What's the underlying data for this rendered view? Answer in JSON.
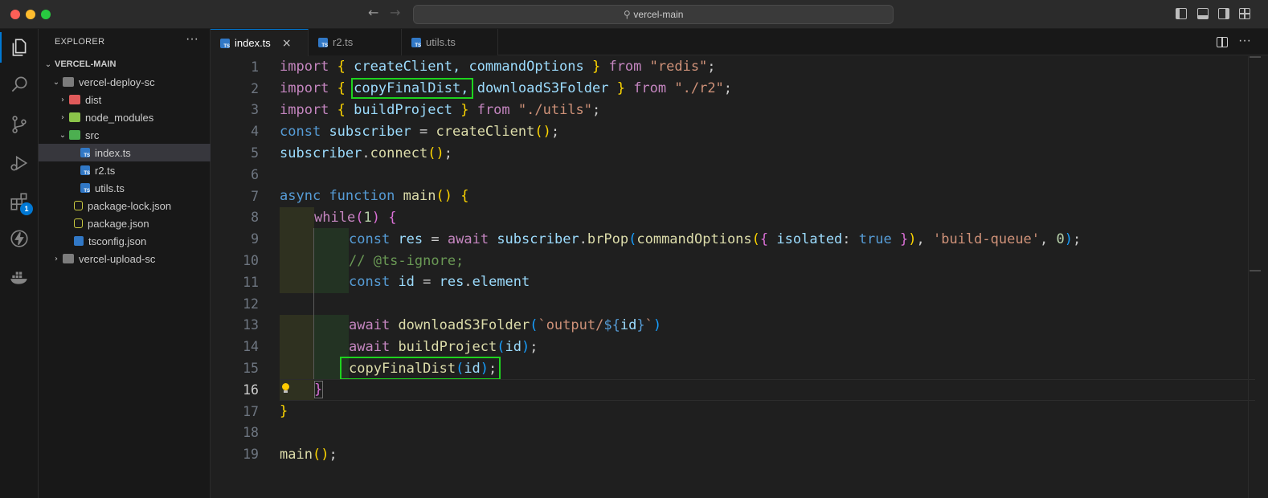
{
  "window": {
    "search_text": "vercel-main"
  },
  "activity_bar": {
    "extensions_badge": "1"
  },
  "sidebar": {
    "title": "EXPLORER",
    "more": "···",
    "root": "VERCEL-MAIN",
    "items": [
      {
        "label": "vercel-deploy-sc"
      },
      {
        "label": "dist"
      },
      {
        "label": "node_modules"
      },
      {
        "label": "src"
      },
      {
        "label": "index.ts"
      },
      {
        "label": "r2.ts"
      },
      {
        "label": "utils.ts"
      },
      {
        "label": "package-lock.json"
      },
      {
        "label": "package.json"
      },
      {
        "label": "tsconfig.json"
      },
      {
        "label": "vercel-upload-sc"
      }
    ]
  },
  "tabs": [
    {
      "label": "index.ts",
      "close": "×"
    },
    {
      "label": "r2.ts"
    },
    {
      "label": "utils.ts"
    }
  ],
  "editor": {
    "line_numbers": [
      "1",
      "2",
      "3",
      "4",
      "5",
      "6",
      "7",
      "8",
      "9",
      "10",
      "11",
      "12",
      "13",
      "14",
      "15",
      "16",
      "17",
      "18",
      "19"
    ],
    "current_line": "16",
    "lines": {
      "l1": [
        "import",
        " ",
        "{",
        " createClient, commandOptions ",
        "}",
        " from ",
        "\"redis\"",
        ";"
      ],
      "l2": [
        "import",
        " ",
        "{",
        " ",
        "copyFinalDist",
        ", downloadS3Folder ",
        "}",
        " from ",
        "\"./r2\"",
        ";"
      ],
      "l3": [
        "import",
        " ",
        "{",
        " buildProject ",
        "}",
        " from ",
        "\"./utils\"",
        ";"
      ],
      "l4": [
        "const",
        " ",
        "subscriber",
        " = ",
        "createClient",
        "(",
        ")",
        ";"
      ],
      "l5": [
        "subscriber",
        ".",
        "connect",
        "(",
        ")",
        ";"
      ],
      "l7": [
        "async",
        " ",
        "function",
        " ",
        "main",
        "(",
        ")",
        " ",
        "{"
      ],
      "l8": [
        "while",
        "(",
        "1",
        ")",
        " ",
        "{"
      ],
      "l9": [
        "const",
        " ",
        "res",
        " = ",
        "await",
        " ",
        "subscriber",
        ".",
        "brPop",
        "(",
        "commandOptions",
        "(",
        "{",
        " ",
        "isolated",
        ": ",
        "true",
        " ",
        "}",
        ")",
        ", ",
        "'build-queue'",
        ", ",
        "0",
        ")",
        ";"
      ],
      "l10": [
        "// @ts-ignore;"
      ],
      "l11": [
        "const",
        " ",
        "id",
        " = ",
        "res",
        ".",
        "element"
      ],
      "l13": [
        "await",
        " ",
        "downloadS3Folder",
        "(",
        "`output/",
        "${",
        "id",
        "}",
        "`",
        ")"
      ],
      "l14": [
        "await",
        " ",
        "buildProject",
        "(",
        "id",
        ")",
        ";"
      ],
      "l15": [
        "copyFinalDist",
        "(",
        "id",
        ")",
        ";"
      ],
      "l16": [
        "}"
      ],
      "l17": [
        "}"
      ],
      "l19": [
        "main",
        "(",
        ")",
        ";"
      ]
    }
  },
  "colors": {
    "accent": "#0078d4",
    "highlight_box": "#1ed31e"
  }
}
